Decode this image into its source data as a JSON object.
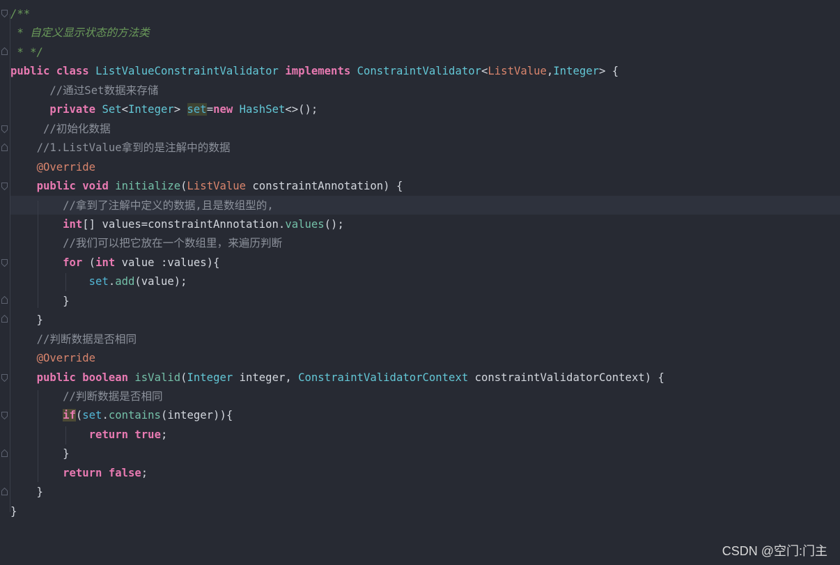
{
  "editor": {
    "lines": [
      [
        {
          "t": "/**",
          "c": "doc"
        }
      ],
      [
        {
          "t": " * 自定义显示状态的方法类",
          "c": "doc"
        }
      ],
      [
        {
          "t": " * */",
          "c": "doc"
        }
      ],
      [
        {
          "t": "public",
          "c": "kw"
        },
        {
          "t": " "
        },
        {
          "t": "class",
          "c": "kw"
        },
        {
          "t": " "
        },
        {
          "t": "ListValueConstraintValidator",
          "c": "cls"
        },
        {
          "t": " "
        },
        {
          "t": "implements",
          "c": "kw"
        },
        {
          "t": " "
        },
        {
          "t": "ConstraintValidator",
          "c": "cls"
        },
        {
          "t": "<"
        },
        {
          "t": "ListValue",
          "c": "ann"
        },
        {
          "t": ","
        },
        {
          "t": "Integer",
          "c": "cls"
        },
        {
          "t": "> {"
        }
      ],
      [
        {
          "t": "      "
        },
        {
          "t": "//通过Set数据来存储",
          "c": "cm"
        }
      ],
      [
        {
          "t": "      "
        },
        {
          "t": "private",
          "c": "kw"
        },
        {
          "t": " "
        },
        {
          "t": "Set",
          "c": "cls"
        },
        {
          "t": "<"
        },
        {
          "t": "Integer",
          "c": "cls"
        },
        {
          "t": "> "
        },
        {
          "t": "set",
          "c": "fld hl-set"
        },
        {
          "t": "="
        },
        {
          "t": "new",
          "c": "kw"
        },
        {
          "t": " "
        },
        {
          "t": "HashSet",
          "c": "cls"
        },
        {
          "t": "<>();"
        }
      ],
      [
        {
          "t": "     "
        },
        {
          "t": "//初始化数据",
          "c": "cm"
        }
      ],
      [
        {
          "t": "    "
        },
        {
          "t": "//1.ListValue拿到的是注解中的数据",
          "c": "cm"
        }
      ],
      [
        {
          "t": "    "
        },
        {
          "t": "@Override",
          "c": "ann"
        }
      ],
      [
        {
          "t": "    "
        },
        {
          "t": "public",
          "c": "kw"
        },
        {
          "t": " "
        },
        {
          "t": "void",
          "c": "kw"
        },
        {
          "t": " "
        },
        {
          "t": "initialize",
          "c": "fn"
        },
        {
          "t": "("
        },
        {
          "t": "ListValue",
          "c": "ann"
        },
        {
          "t": " constraintAnnotation) {"
        }
      ],
      [
        {
          "t": "        "
        },
        {
          "t": "//拿到了注解中定义的数据,且是数组型的,",
          "c": "cm"
        }
      ],
      [
        {
          "t": "        "
        },
        {
          "t": "int",
          "c": "kw"
        },
        {
          "t": "[] values=constraintAnnotation."
        },
        {
          "t": "values",
          "c": "fn"
        },
        {
          "t": "();"
        }
      ],
      [
        {
          "t": "        "
        },
        {
          "t": "//我们可以把它放在一个数组里，来遍历判断",
          "c": "cm"
        }
      ],
      [
        {
          "t": "        "
        },
        {
          "t": "for",
          "c": "kw"
        },
        {
          "t": " ("
        },
        {
          "t": "int",
          "c": "kw"
        },
        {
          "t": " value :values){"
        }
      ],
      [
        {
          "t": "            "
        },
        {
          "t": "set",
          "c": "fld"
        },
        {
          "t": "."
        },
        {
          "t": "add",
          "c": "fn"
        },
        {
          "t": "(value);"
        }
      ],
      [
        {
          "t": "        }"
        }
      ],
      [
        {
          "t": "    }"
        }
      ],
      [
        {
          "t": "    "
        },
        {
          "t": "//判断数据是否相同",
          "c": "cm"
        }
      ],
      [
        {
          "t": "    "
        },
        {
          "t": "@Override",
          "c": "ann"
        }
      ],
      [
        {
          "t": "    "
        },
        {
          "t": "public",
          "c": "kw"
        },
        {
          "t": " "
        },
        {
          "t": "boolean",
          "c": "kw"
        },
        {
          "t": " "
        },
        {
          "t": "isValid",
          "c": "fn"
        },
        {
          "t": "("
        },
        {
          "t": "Integer",
          "c": "cls"
        },
        {
          "t": " integer, "
        },
        {
          "t": "ConstraintValidatorContext",
          "c": "cls"
        },
        {
          "t": " constraintValidatorContext) {"
        }
      ],
      [
        {
          "t": "        "
        },
        {
          "t": "//判断数据是否相同",
          "c": "cm"
        }
      ],
      [
        {
          "t": "        "
        },
        {
          "t": "if",
          "c": "kw hl"
        },
        {
          "t": "("
        },
        {
          "t": "set",
          "c": "fld"
        },
        {
          "t": "."
        },
        {
          "t": "contains",
          "c": "fn"
        },
        {
          "t": "(integer)){"
        }
      ],
      [
        {
          "t": "            "
        },
        {
          "t": "return",
          "c": "kw"
        },
        {
          "t": " "
        },
        {
          "t": "true",
          "c": "kw"
        },
        {
          "t": ";"
        }
      ],
      [
        {
          "t": "        }"
        }
      ],
      [
        {
          "t": "        "
        },
        {
          "t": "return",
          "c": "kw"
        },
        {
          "t": " "
        },
        {
          "t": "false",
          "c": "kw"
        },
        {
          "t": ";"
        }
      ],
      [
        {
          "t": "    }"
        }
      ],
      [
        {
          "t": "}"
        }
      ]
    ]
  },
  "watermark": "CSDN @空门:门主",
  "colors": {
    "background": "#272a33",
    "keyword": "#e87ab2",
    "class": "#63c7d6",
    "annotation": "#d9856d",
    "comment": "#8c919b",
    "javadoc": "#6a9a5a"
  }
}
